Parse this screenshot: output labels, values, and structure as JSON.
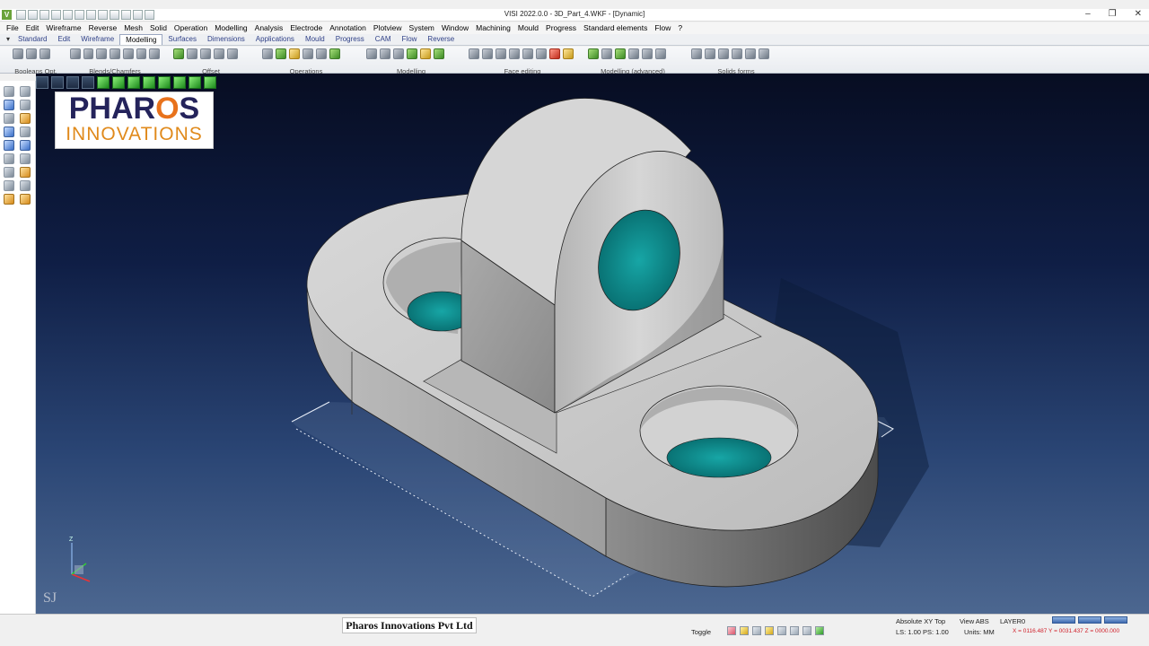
{
  "window": {
    "title": "VISI 2022.0.0 - 3D_Part_4.WKF - [Dynamic]",
    "app_icon": "V",
    "controls": [
      "–",
      "❐",
      "✕"
    ]
  },
  "menu": [
    "File",
    "Edit",
    "Wireframe",
    "Reverse",
    "Mesh",
    "Solid",
    "Operation",
    "Modelling",
    "Analysis",
    "Electrode",
    "Annotation",
    "Plotview",
    "System",
    "Window",
    "Machining",
    "Mould",
    "Progress",
    "Standard elements",
    "Flow",
    "?"
  ],
  "ribbon_tabs": [
    "Standard",
    "Edit",
    "Wireframe",
    "Modelling",
    "Surfaces",
    "Dimensions",
    "Applications",
    "Mould",
    "Progress",
    "CAM",
    "Flow",
    "Reverse"
  ],
  "ribbon_active_tab": "Modelling",
  "ribbon_groups": [
    "Booleans Opt.",
    "Blends/Chamfers",
    "Offset",
    "Operations",
    "Modelling",
    "Face editing",
    "Modelling (advanced)",
    "Solids forms"
  ],
  "logo": {
    "line1_a": "PHAR",
    "line1_b": "O",
    "line1_c": "S",
    "line2": "INNOVATIONS"
  },
  "watermark": "SJ",
  "axis_labels": {
    "z": "Z"
  },
  "status": {
    "company": "Pharos Innovations Pvt Ltd",
    "toggle": "Toggle",
    "view_mode": "Absolute XY Top",
    "view_abs": "View ABS",
    "layer": "LAYER0",
    "scale": "LS: 1.00 PS: 1.00",
    "units": "Units: MM",
    "coords": "X = 0116.487 Y = 0031.437 Z = 0000.000"
  },
  "colors": {
    "hole": "#0f8d8d",
    "part": "#bfbfbf",
    "viewport_top": "#070d22",
    "viewport_bottom": "#4c6790"
  }
}
